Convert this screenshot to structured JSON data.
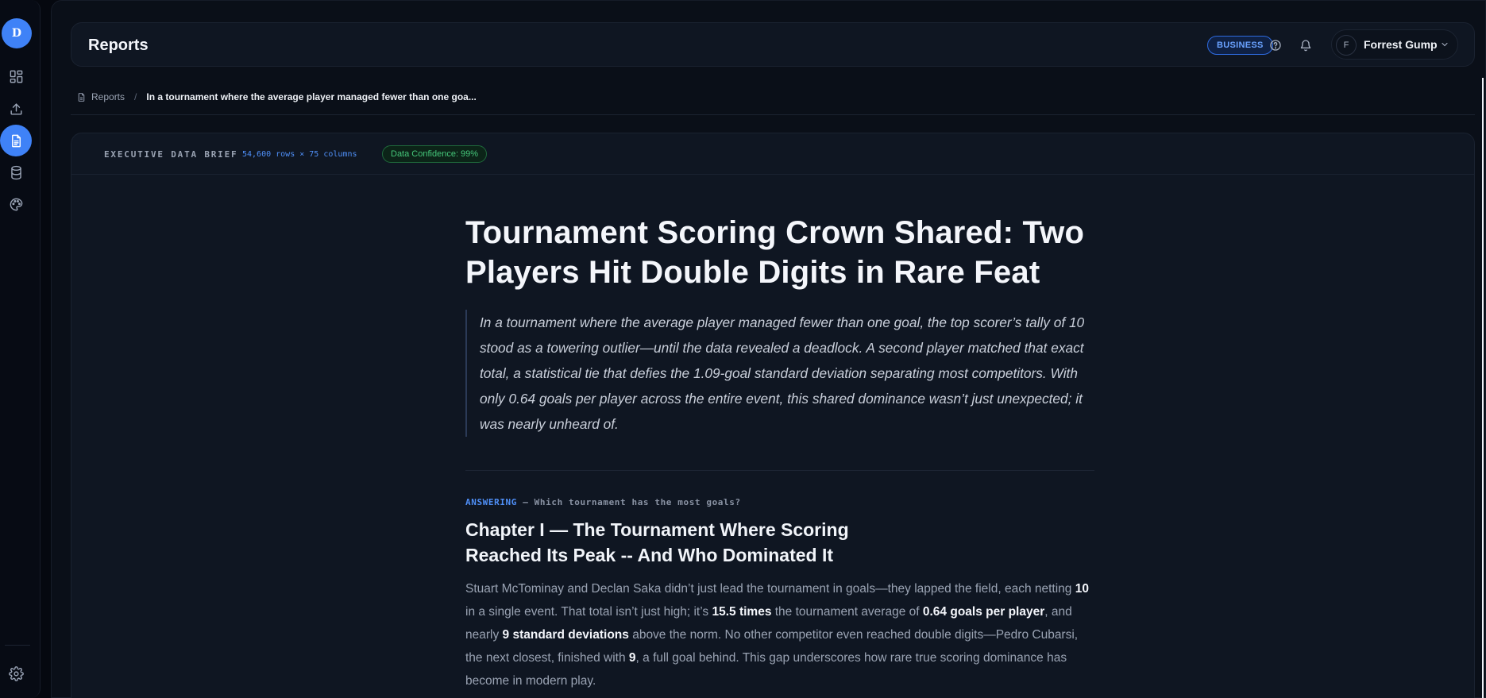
{
  "sidebar": {
    "logo_letter": "D",
    "items": [
      {
        "name": "dashboard-icon",
        "active": false
      },
      {
        "name": "upload-icon",
        "active": false
      },
      {
        "name": "reports-icon",
        "active": true
      },
      {
        "name": "database-icon",
        "active": false
      },
      {
        "name": "palette-icon",
        "active": false
      }
    ],
    "footer_icon": "settings-icon"
  },
  "topbar": {
    "title": "Reports",
    "plan_badge": "BUSINESS",
    "help_icon": "help-circle-icon",
    "notifications_icon": "bell-icon",
    "user": {
      "initial": "F",
      "name": "Forrest Gump"
    }
  },
  "breadcrumb": {
    "root": "Reports",
    "separator": "/",
    "current": "In a tournament where the average player managed fewer than one goa..."
  },
  "brief": {
    "label": "EXECUTIVE DATA BRIEF",
    "dimensions": "54,600 rows × 75 columns",
    "confidence": "Data Confidence: 99%"
  },
  "article": {
    "headline": "Tournament Scoring Crown Shared: Two Players Hit Double Digits in Rare Feat",
    "lede": "In a tournament where the average player managed fewer than one goal, the top scorer’s tally of 10 stood as a towering outlier—until the data revealed a deadlock. A second player matched that exact total, a statistical tie that defies the 1.09-goal standard deviation separating most competitors. With only 0.64 goals per player across the entire event, this shared dominance wasn’t just unexpected; it was nearly unheard of.",
    "answering_tag": "ANSWERING",
    "answering_question": " — Which tournament has the most goals?",
    "chapter_title": "Chapter I — The Tournament Where Scoring Reached Its Peak -- And Who Dominated It",
    "body": {
      "p1": "Stuart McTominay and Declan Saka didn’t just lead the tournament in goals—they lapped the field, each netting ",
      "b1": "10",
      "p2": " in a single event. That total isn’t just high; it’s ",
      "b2": "15.5 times",
      "p3": " the tournament average of ",
      "b3": "0.64 goals per player",
      "p4": ", and nearly ",
      "b4": "9 standard deviations",
      "p5": " above the norm. No other competitor even reached double digits—Pedro Cubarsi, the next closest, finished with ",
      "b5": "9",
      "p6": ", a full goal behind. This gap underscores how rare true scoring dominance has become in modern play."
    }
  },
  "colors": {
    "accent": "#3f82f7",
    "background": "#0a0f18",
    "panel": "#0f1622",
    "confidence_green": "#45c77a"
  }
}
